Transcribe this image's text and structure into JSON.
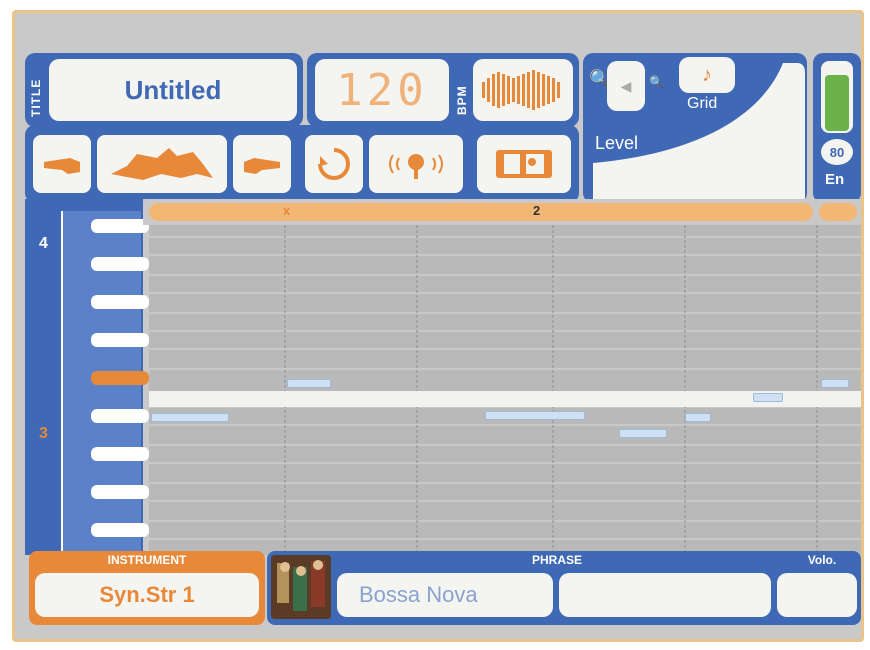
{
  "header": {
    "title_label": "TITLE",
    "title_value": "Untitled",
    "tempo_value": "120",
    "bpm_label": "BPM",
    "grid_label": "Grid",
    "level_label": "Level",
    "en_value": "80",
    "en_label": "En"
  },
  "toolbar": {
    "buttons": [
      {
        "icon": "hand-left-icon"
      },
      {
        "icon": "animal-silhouette-icon"
      },
      {
        "icon": "hand-right-icon"
      },
      {
        "icon": "loop-icon"
      },
      {
        "icon": "speaker-icon"
      },
      {
        "icon": "film-icon"
      }
    ]
  },
  "timeline": {
    "measure_2": "2",
    "marker_1": "x"
  },
  "keyboard": {
    "octave_top": "4",
    "octave_mid": "3"
  },
  "footer": {
    "instrument_label": "INSTRUMENT",
    "instrument_value": "Syn.Str 1",
    "phrase_label": "PHRASE",
    "phrase_value": "Bossa Nova",
    "volo_label": "Volo."
  },
  "colors": {
    "accent_orange": "#e8893a",
    "panel_blue": "#3f68b5",
    "level_green": "#6bb24a"
  }
}
